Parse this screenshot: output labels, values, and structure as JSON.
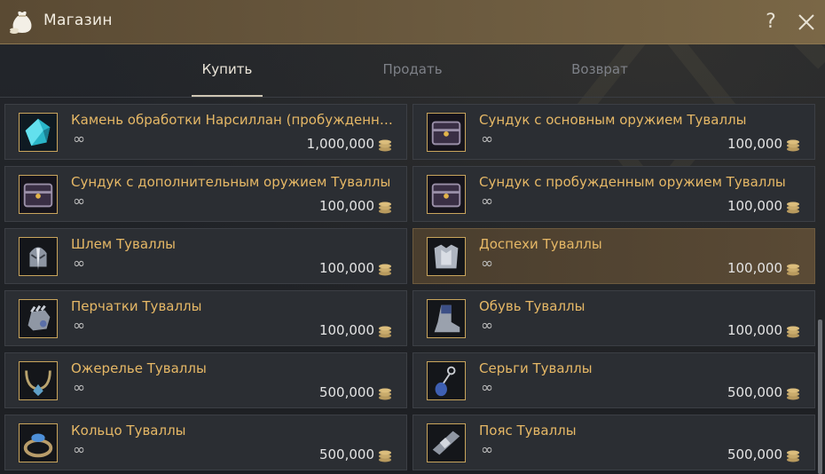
{
  "window": {
    "title": "Магазин",
    "help_label": "?"
  },
  "tabs": [
    {
      "label": "Купить",
      "active": true
    },
    {
      "label": "Продать",
      "active": false
    },
    {
      "label": "Возврат",
      "active": false
    }
  ],
  "items": [
    {
      "name": "Камень обработки Нарсиллан (пробужденное...",
      "quantity": "∞",
      "price": "1,000,000",
      "icon": "gem-icon"
    },
    {
      "name": "Сундук с основным оружием Туваллы",
      "quantity": "∞",
      "price": "100,000",
      "icon": "chest-icon"
    },
    {
      "name": "Сундук с дополнительным оружием Туваллы",
      "quantity": "∞",
      "price": "100,000",
      "icon": "chest-icon"
    },
    {
      "name": "Сундук с пробужденным оружием Туваллы",
      "quantity": "∞",
      "price": "100,000",
      "icon": "chest-icon"
    },
    {
      "name": "Шлем Туваллы",
      "quantity": "∞",
      "price": "100,000",
      "icon": "helmet-icon"
    },
    {
      "name": "Доспехи Туваллы",
      "quantity": "∞",
      "price": "100,000",
      "icon": "armor-icon",
      "selected": true
    },
    {
      "name": "Перчатки Туваллы",
      "quantity": "∞",
      "price": "100,000",
      "icon": "gloves-icon"
    },
    {
      "name": "Обувь Туваллы",
      "quantity": "∞",
      "price": "100,000",
      "icon": "boots-icon"
    },
    {
      "name": "Ожерелье Туваллы",
      "quantity": "∞",
      "price": "500,000",
      "icon": "necklace-icon"
    },
    {
      "name": "Серьги Туваллы",
      "quantity": "∞",
      "price": "500,000",
      "icon": "earring-icon"
    },
    {
      "name": "Кольцо Туваллы",
      "quantity": "∞",
      "price": "500,000",
      "icon": "ring-icon"
    },
    {
      "name": "Пояс Туваллы",
      "quantity": "∞",
      "price": "500,000",
      "icon": "belt-icon"
    }
  ]
}
